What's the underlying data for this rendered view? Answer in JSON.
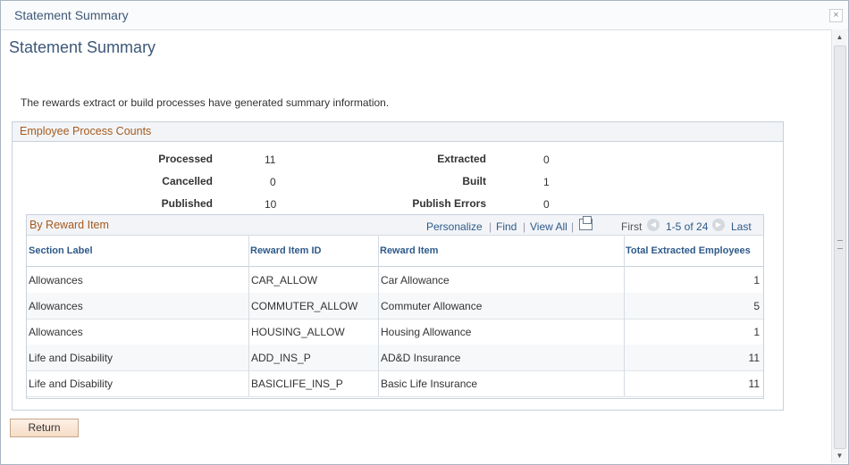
{
  "window": {
    "title": "Statement Summary"
  },
  "page": {
    "title": "Statement Summary",
    "intro": "The rewards extract or build processes have generated summary information."
  },
  "counts": {
    "title": "Employee Process Counts",
    "items": [
      {
        "label": "Processed",
        "value": "11"
      },
      {
        "label": "Extracted",
        "value": "0"
      },
      {
        "label": "Cancelled",
        "value": "0"
      },
      {
        "label": "Built",
        "value": "1"
      },
      {
        "label": "Published",
        "value": "10"
      },
      {
        "label": "Publish Errors",
        "value": "0"
      }
    ]
  },
  "grid": {
    "title": "By Reward Item",
    "nav": {
      "personalize": "Personalize",
      "find": "Find",
      "view_all": "View All",
      "first": "First",
      "range": "1-5 of 24",
      "last": "Last",
      "sep": "|"
    },
    "columns": [
      "Section Label",
      "Reward Item ID",
      "Reward Item",
      "Total Extracted Employees"
    ],
    "rows": [
      [
        "Allowances",
        "CAR_ALLOW",
        "Car Allowance",
        "1"
      ],
      [
        "Allowances",
        "COMMUTER_ALLOW",
        "Commuter Allowance",
        "5"
      ],
      [
        "Allowances",
        "HOUSING_ALLOW",
        "Housing Allowance",
        "1"
      ],
      [
        "Life and Disability",
        "ADD_INS_P",
        "AD&D Insurance",
        "11"
      ],
      [
        "Life and Disability",
        "BASICLIFE_INS_P",
        "Basic Life Insurance",
        "11"
      ]
    ]
  },
  "buttons": {
    "return": "Return",
    "close": "×"
  },
  "icons": {
    "close": "close-icon",
    "download": "download-icon",
    "prev": "arrow-left-icon",
    "next": "arrow-right-icon"
  }
}
